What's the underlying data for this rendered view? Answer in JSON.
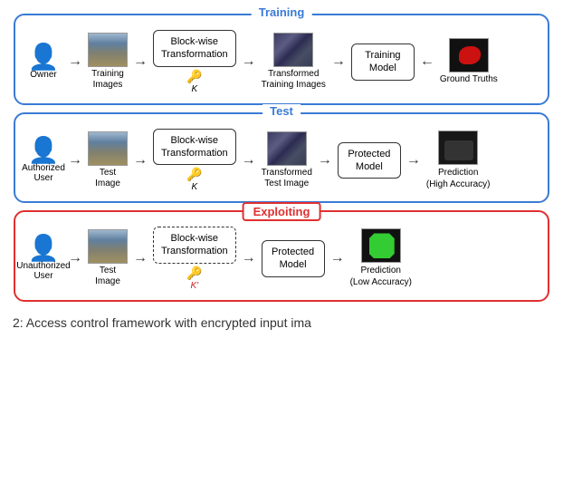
{
  "panels": {
    "training": {
      "title": "Training",
      "label": "Training",
      "owner_label": "Owner",
      "training_images_label": "Training\nImages",
      "block_wise_label": "Block-wise\nTransformation",
      "key_label": "K",
      "transformed_label": "Transformed\nTraining Images",
      "model_label": "Training\nModel",
      "ground_truths_label": "Ground Truths"
    },
    "test": {
      "title": "Test",
      "label": "Test",
      "user_label": "Authorized User",
      "test_image_label": "Test\nImage",
      "block_wise_label": "Block-wise\nTransformation",
      "key_label": "K",
      "transformed_label": "Transformed\nTest Image",
      "model_label": "Protected\nModel",
      "prediction_label": "Prediction\n(High Accuracy)"
    },
    "exploiting": {
      "title": "Exploiting",
      "label": "Exploiting",
      "user_label": "Unauthorized\nUser",
      "test_image_label": "Test\nImage",
      "block_wise_label": "Block-wise\nTransformation",
      "key_label": "K'",
      "transformed_label": "",
      "model_label": "Protected\nModel",
      "prediction_label": "Prediction\n(Low Accuracy)"
    }
  },
  "caption": "2: Access control framework with encrypted input ima"
}
